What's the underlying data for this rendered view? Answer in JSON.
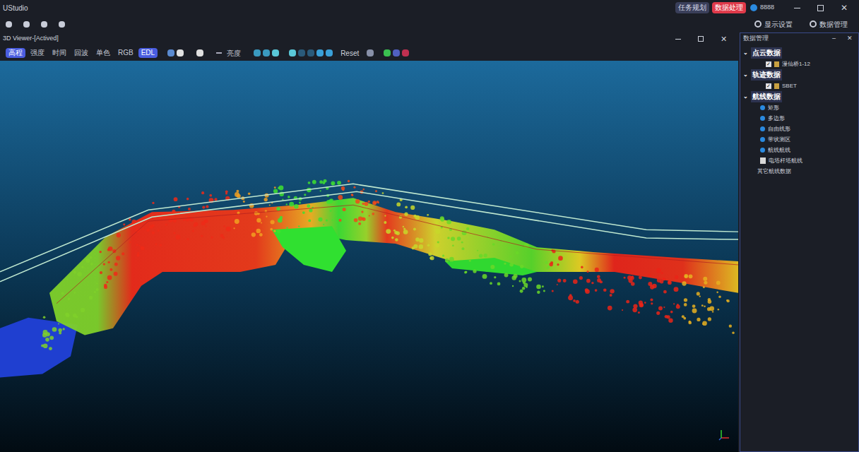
{
  "window": {
    "title": "UStudio"
  },
  "header_buttons": [
    {
      "label": "任务规划",
      "selected": false
    },
    {
      "label": "数据处理",
      "selected": true
    }
  ],
  "user": {
    "name": "8888"
  },
  "toolbar_right": [
    "显示设置",
    "数据管理"
  ],
  "viewer": {
    "title": "3D Viewer-[Actived]",
    "render_modes": [
      {
        "label": "高程",
        "selected": true
      },
      {
        "label": "强度",
        "selected": false
      },
      {
        "label": "时间",
        "selected": false
      },
      {
        "label": "回波",
        "selected": false
      },
      {
        "label": "单色",
        "selected": false
      },
      {
        "label": "RGB",
        "selected": false
      },
      {
        "label": "EDL",
        "selected": true
      }
    ],
    "brightness_label": "亮度",
    "reset_label": "Reset"
  },
  "panel": {
    "title": "数据管理",
    "groups": [
      {
        "label": "点云数据",
        "expanded": true,
        "items": [
          {
            "label": "漫仙桥1-12",
            "checked": true,
            "kind": "file"
          }
        ]
      },
      {
        "label": "轨迹数据",
        "expanded": true,
        "items": [
          {
            "label": "SBET",
            "checked": true,
            "kind": "file"
          }
        ]
      },
      {
        "label": "航线数据",
        "expanded": true,
        "items": [
          {
            "label": "矩形",
            "checked": false,
            "kind": "route"
          },
          {
            "label": "多边形",
            "checked": false,
            "kind": "route"
          },
          {
            "label": "自由线形",
            "checked": false,
            "kind": "route"
          },
          {
            "label": "带状测区",
            "checked": false,
            "kind": "route"
          },
          {
            "label": "航线航线",
            "checked": false,
            "kind": "route"
          },
          {
            "label": "电塔杆塔航线",
            "checked": false,
            "kind": "tower"
          },
          {
            "label": "其它航线数据",
            "checked": false,
            "kind": "plain"
          }
        ]
      }
    ]
  }
}
